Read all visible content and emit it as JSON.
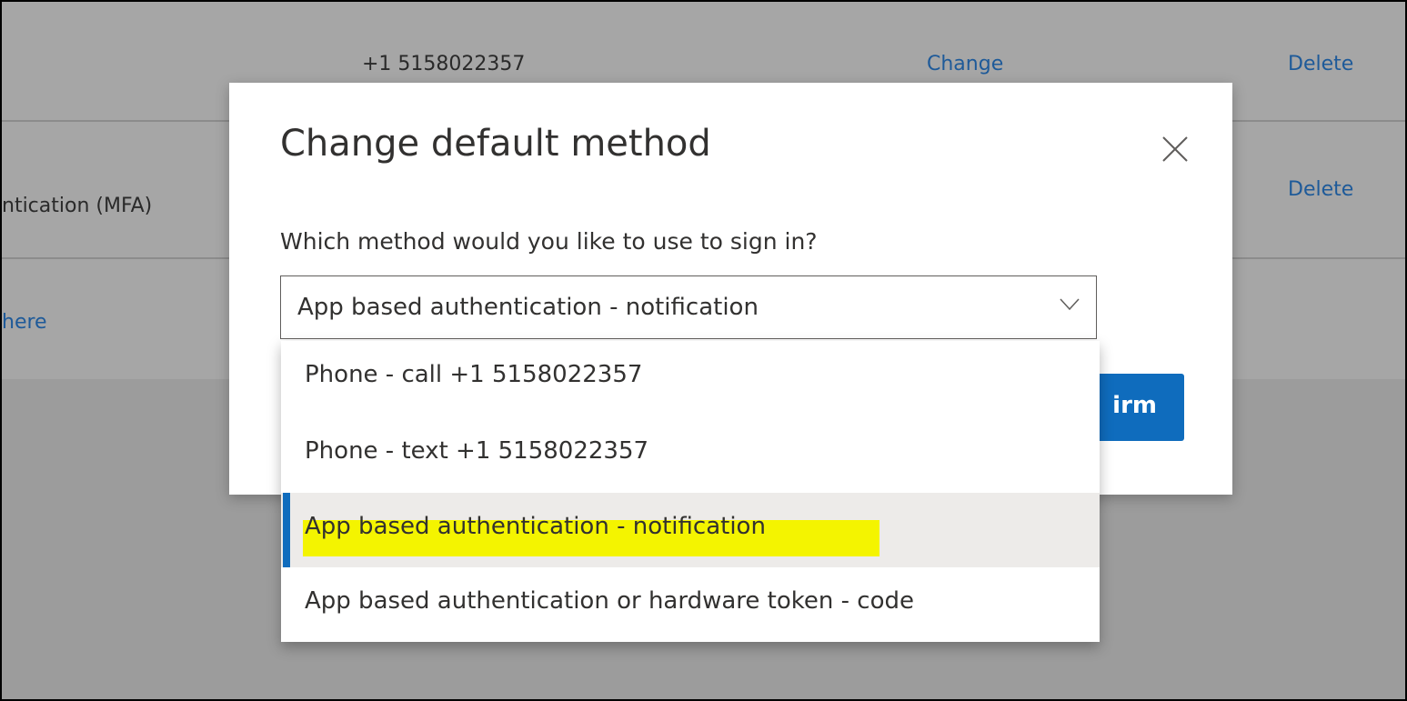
{
  "background": {
    "row1": {
      "phone": "+1 5158022357",
      "change_link": "Change",
      "delete_link": "Delete"
    },
    "row2": {
      "method_partial": "ntication (MFA)",
      "delete_link": "Delete"
    },
    "link_partial": "here"
  },
  "dialog": {
    "title": "Change default method",
    "close_icon": "close-icon",
    "prompt": "Which method would you like to use to sign in?",
    "select": {
      "value": "App based authentication - notification",
      "chevron_icon": "chevron-down-icon"
    },
    "confirm_partial_label": "irm"
  },
  "dropdown": {
    "options": [
      {
        "label": "Phone - call +1 5158022357",
        "selected": false
      },
      {
        "label": "Phone - text +1 5158022357",
        "selected": false
      },
      {
        "label": "App based authentication - notification",
        "selected": true,
        "highlighted": true
      },
      {
        "label": "App based authentication or hardware token - code",
        "selected": false
      }
    ]
  },
  "colors": {
    "accent": "#0f6cbd",
    "highlight": "#f4f400",
    "overlay": "#9c9c9c",
    "selected_bg": "#edebe9"
  }
}
